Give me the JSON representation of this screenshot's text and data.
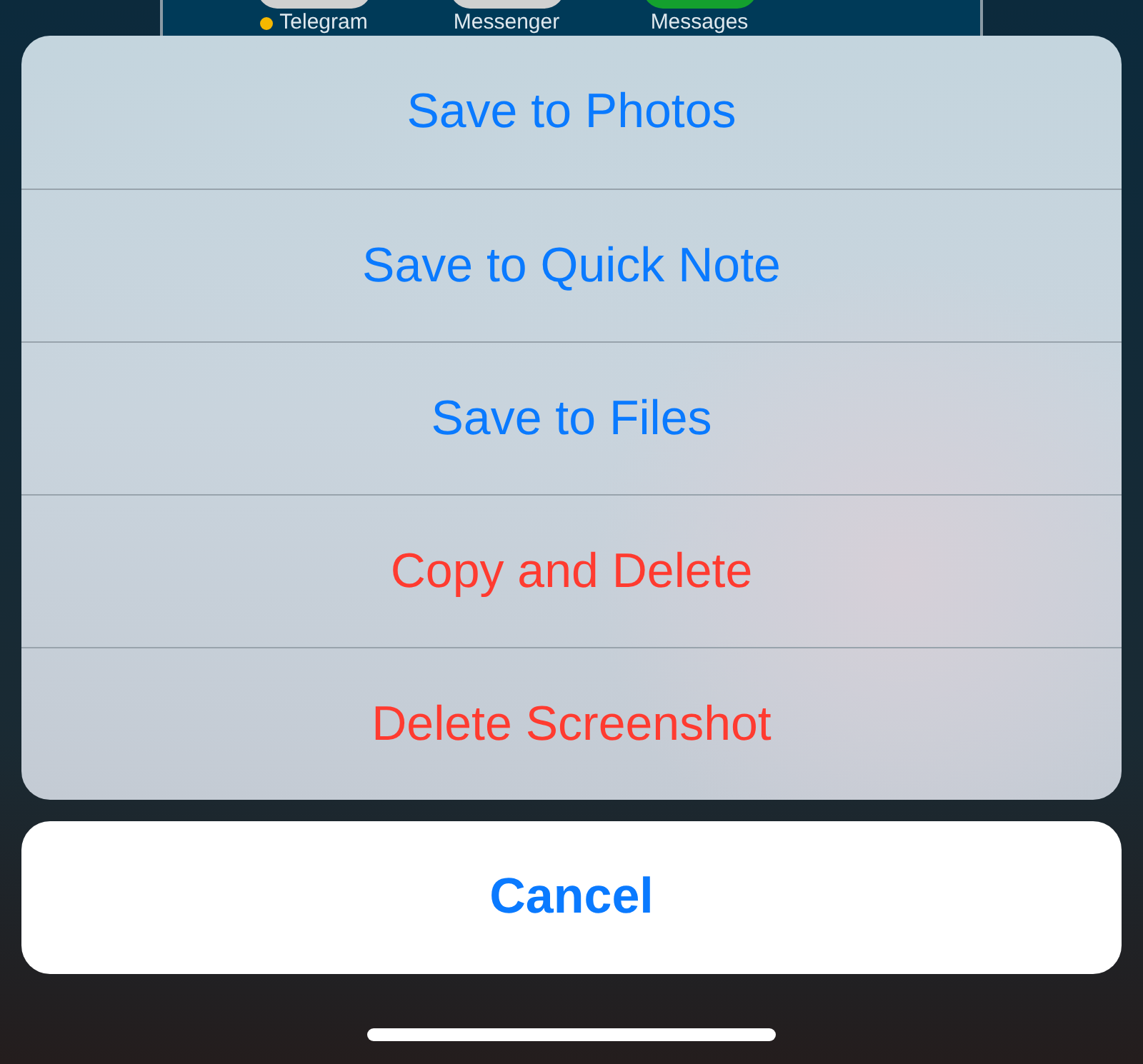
{
  "home_screen": {
    "apps": [
      {
        "label": "Telegram",
        "new": true
      },
      {
        "label": "Messenger",
        "new": false
      },
      {
        "label": "Messages",
        "new": false
      }
    ]
  },
  "action_sheet": {
    "actions": [
      {
        "label": "Save to Photos",
        "kind": "default"
      },
      {
        "label": "Save to Quick Note",
        "kind": "default"
      },
      {
        "label": "Save to Files",
        "kind": "default"
      },
      {
        "label": "Copy and Delete",
        "kind": "destructive"
      },
      {
        "label": "Delete Screenshot",
        "kind": "destructive"
      }
    ],
    "cancel": "Cancel"
  }
}
